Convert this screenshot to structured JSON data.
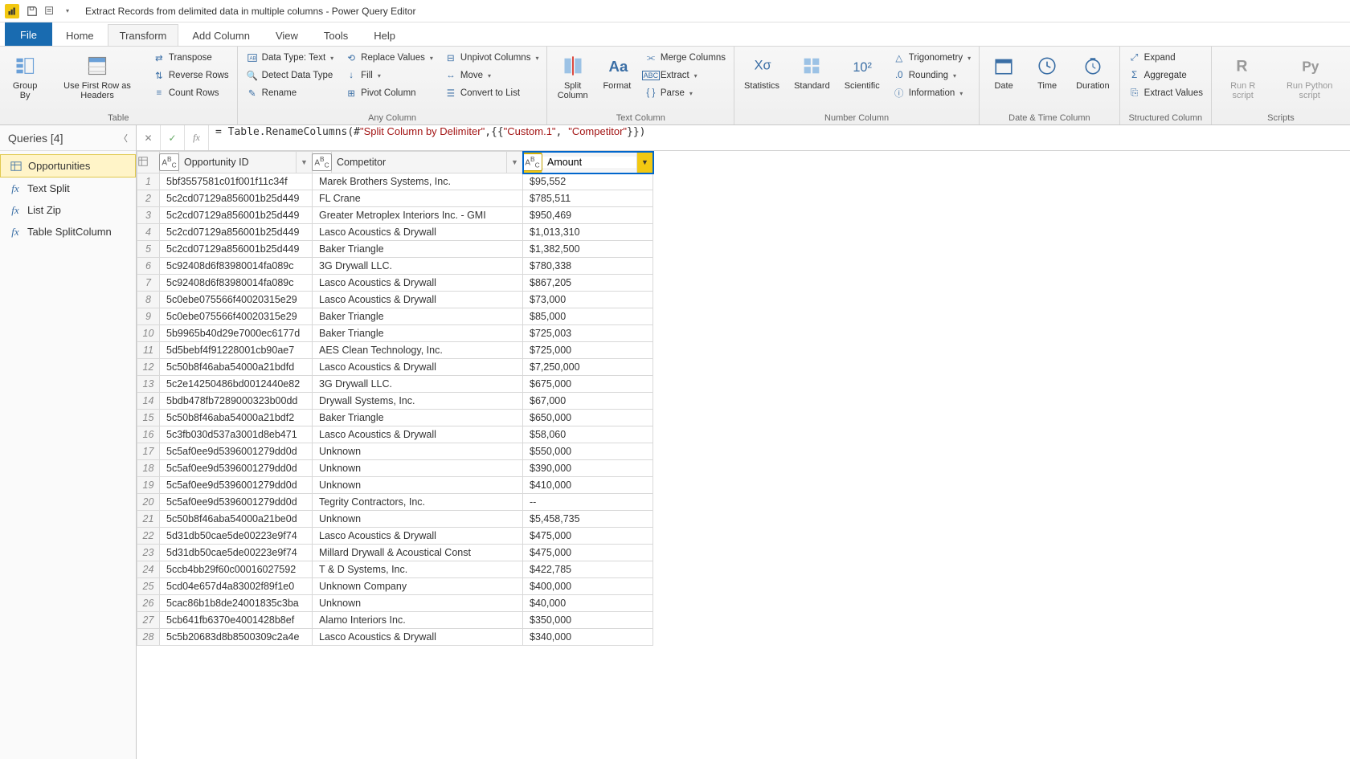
{
  "title": "Extract Records from delimited data in multiple columns - Power Query Editor",
  "tabs": [
    "File",
    "Home",
    "Transform",
    "Add Column",
    "View",
    "Tools",
    "Help"
  ],
  "active_tab": 2,
  "ribbon": {
    "table": {
      "group_by": "Group By",
      "use_first_row": "Use First Row as Headers",
      "transpose": "Transpose",
      "reverse_rows": "Reverse Rows",
      "count_rows": "Count Rows",
      "label": "Table"
    },
    "any_column": {
      "data_type": "Data Type: Text",
      "detect": "Detect Data Type",
      "rename": "Rename",
      "replace": "Replace Values",
      "fill": "Fill",
      "pivot": "Pivot Column",
      "unpivot": "Unpivot Columns",
      "move": "Move",
      "convert": "Convert to List",
      "label": "Any Column"
    },
    "text_column": {
      "split": "Split Column",
      "format": "Format",
      "merge": "Merge Columns",
      "extract": "Extract",
      "parse": "Parse",
      "label": "Text Column"
    },
    "number_column": {
      "statistics": "Statistics",
      "standard": "Standard",
      "scientific": "Scientific",
      "trig": "Trigonometry",
      "rounding": "Rounding",
      "info": "Information",
      "label": "Number Column"
    },
    "datetime": {
      "date": "Date",
      "time": "Time",
      "duration": "Duration",
      "label": "Date & Time Column"
    },
    "structured": {
      "expand": "Expand",
      "aggregate": "Aggregate",
      "extract_values": "Extract Values",
      "label": "Structured Column"
    },
    "scripts": {
      "r": "Run R script",
      "py": "Run Python script",
      "label": "Scripts"
    }
  },
  "queries": {
    "header": "Queries [4]",
    "items": [
      "Opportunities",
      "Text Split",
      "List Zip",
      "Table SplitColumn"
    ],
    "selected": 0
  },
  "formula": "= Table.RenameColumns(#\"Split Column by Delimiter\",{{\"Custom.1\", \"Competitor\"}})",
  "columns": [
    {
      "name": "Opportunity ID",
      "type": "ABC"
    },
    {
      "name": "Competitor",
      "type": "ABC"
    },
    {
      "name": "Amount",
      "type": "ABC",
      "editing": true
    }
  ],
  "rows": [
    {
      "n": 1,
      "id": "5bf3557581c01f001f11c34f",
      "comp": "Marek Brothers Systems, Inc.",
      "amt": "$95,552"
    },
    {
      "n": 2,
      "id": "5c2cd07129a856001b25d449",
      "comp": "FL Crane",
      "amt": "$785,511"
    },
    {
      "n": 3,
      "id": "5c2cd07129a856001b25d449",
      "comp": "Greater Metroplex Interiors  Inc. - GMI",
      "amt": "$950,469"
    },
    {
      "n": 4,
      "id": "5c2cd07129a856001b25d449",
      "comp": "Lasco Acoustics & Drywall",
      "amt": "$1,013,310"
    },
    {
      "n": 5,
      "id": "5c2cd07129a856001b25d449",
      "comp": "Baker Triangle",
      "amt": "$1,382,500"
    },
    {
      "n": 6,
      "id": "5c92408d6f83980014fa089c",
      "comp": "3G Drywall LLC.",
      "amt": "$780,338"
    },
    {
      "n": 7,
      "id": "5c92408d6f83980014fa089c",
      "comp": "Lasco Acoustics & Drywall",
      "amt": "$867,205"
    },
    {
      "n": 8,
      "id": "5c0ebe075566f40020315e29",
      "comp": "Lasco Acoustics & Drywall",
      "amt": "$73,000"
    },
    {
      "n": 9,
      "id": "5c0ebe075566f40020315e29",
      "comp": "Baker Triangle",
      "amt": "$85,000"
    },
    {
      "n": 10,
      "id": "5b9965b40d29e7000ec6177d",
      "comp": "Baker Triangle",
      "amt": "$725,003"
    },
    {
      "n": 11,
      "id": "5d5bebf4f91228001cb90ae7",
      "comp": "AES Clean Technology, Inc.",
      "amt": "$725,000"
    },
    {
      "n": 12,
      "id": "5c50b8f46aba54000a21bdfd",
      "comp": "Lasco Acoustics & Drywall",
      "amt": "$7,250,000"
    },
    {
      "n": 13,
      "id": "5c2e14250486bd0012440e82",
      "comp": "3G Drywall LLC.",
      "amt": "$675,000"
    },
    {
      "n": 14,
      "id": "5bdb478fb7289000323b00dd",
      "comp": "Drywall Systems, Inc.",
      "amt": "$67,000"
    },
    {
      "n": 15,
      "id": "5c50b8f46aba54000a21bdf2",
      "comp": "Baker Triangle",
      "amt": "$650,000"
    },
    {
      "n": 16,
      "id": "5c3fb030d537a3001d8eb471",
      "comp": "Lasco Acoustics & Drywall",
      "amt": "$58,060"
    },
    {
      "n": 17,
      "id": "5c5af0ee9d5396001279dd0d",
      "comp": "Unknown",
      "amt": "$550,000"
    },
    {
      "n": 18,
      "id": "5c5af0ee9d5396001279dd0d",
      "comp": "Unknown",
      "amt": "$390,000"
    },
    {
      "n": 19,
      "id": "5c5af0ee9d5396001279dd0d",
      "comp": "Unknown",
      "amt": "$410,000"
    },
    {
      "n": 20,
      "id": "5c5af0ee9d5396001279dd0d",
      "comp": "Tegrity Contractors, Inc.",
      "amt": "--"
    },
    {
      "n": 21,
      "id": "5c50b8f46aba54000a21be0d",
      "comp": "Unknown",
      "amt": "$5,458,735"
    },
    {
      "n": 22,
      "id": "5d31db50cae5de00223e9f74",
      "comp": "Lasco Acoustics & Drywall",
      "amt": "$475,000"
    },
    {
      "n": 23,
      "id": "5d31db50cae5de00223e9f74",
      "comp": "Millard Drywall & Acoustical Const",
      "amt": "$475,000"
    },
    {
      "n": 24,
      "id": "5ccb4bb29f60c00016027592",
      "comp": "T & D Systems, Inc.",
      "amt": "$422,785"
    },
    {
      "n": 25,
      "id": "5cd04e657d4a83002f89f1e0",
      "comp": "Unknown Company",
      "amt": "$400,000"
    },
    {
      "n": 26,
      "id": "5cac86b1b8de24001835c3ba",
      "comp": "Unknown",
      "amt": "$40,000"
    },
    {
      "n": 27,
      "id": "5cb641fb6370e4001428b8ef",
      "comp": "Alamo Interiors Inc.",
      "amt": "$350,000"
    },
    {
      "n": 28,
      "id": "5c5b20683d8b8500309c2a4e",
      "comp": "Lasco Acoustics & Drywall",
      "amt": "$340,000"
    }
  ]
}
